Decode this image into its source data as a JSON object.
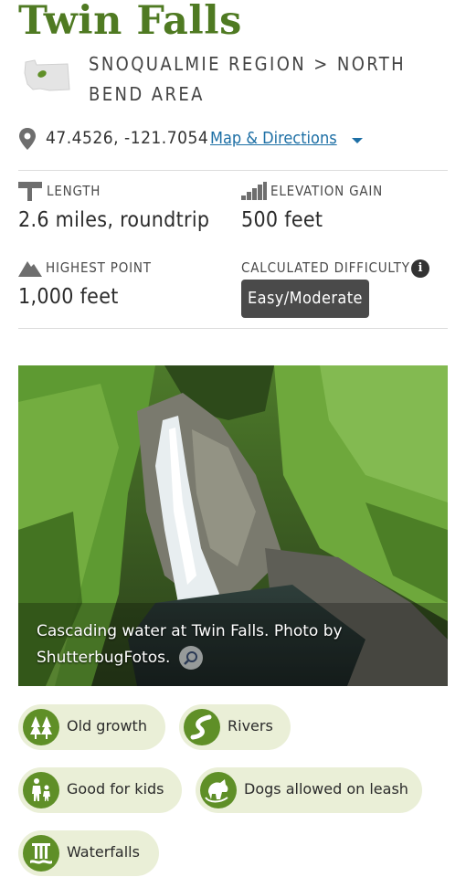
{
  "hike": {
    "title": "Twin Falls",
    "region": "SNOQUALMIE REGION > NORTH BEND AREA",
    "coordinates": "47.4526, -121.7054",
    "map_link_label": "Map & Directions"
  },
  "stats": {
    "length": {
      "label": "LENGTH",
      "value": "2.6 miles, roundtrip"
    },
    "elevation_gain": {
      "label": "ELEVATION GAIN",
      "value": "500 feet"
    },
    "highest_point": {
      "label": "HIGHEST POINT",
      "value": "1,000 feet"
    },
    "difficulty": {
      "label": "CALCULATED DIFFICULTY",
      "info_icon": "i",
      "value": "Easy/Moderate"
    }
  },
  "photo": {
    "caption": "Cascading water at Twin Falls. Photo by ShutterbugFotos."
  },
  "features": [
    {
      "label": "Old growth",
      "icon": "old-growth-icon"
    },
    {
      "label": "Rivers",
      "icon": "rivers-icon"
    },
    {
      "label": "Good for kids",
      "icon": "kids-icon"
    },
    {
      "label": "Dogs allowed on leash",
      "icon": "dog-icon"
    },
    {
      "label": "Waterfalls",
      "icon": "waterfall-icon"
    }
  ],
  "colors": {
    "title_green": "#4f7a22",
    "link_blue": "#1d6fa5",
    "tag_background": "#eaefd7",
    "tag_icon_green": "#5f8f27",
    "difficulty_badge": "#4a4a4a"
  }
}
